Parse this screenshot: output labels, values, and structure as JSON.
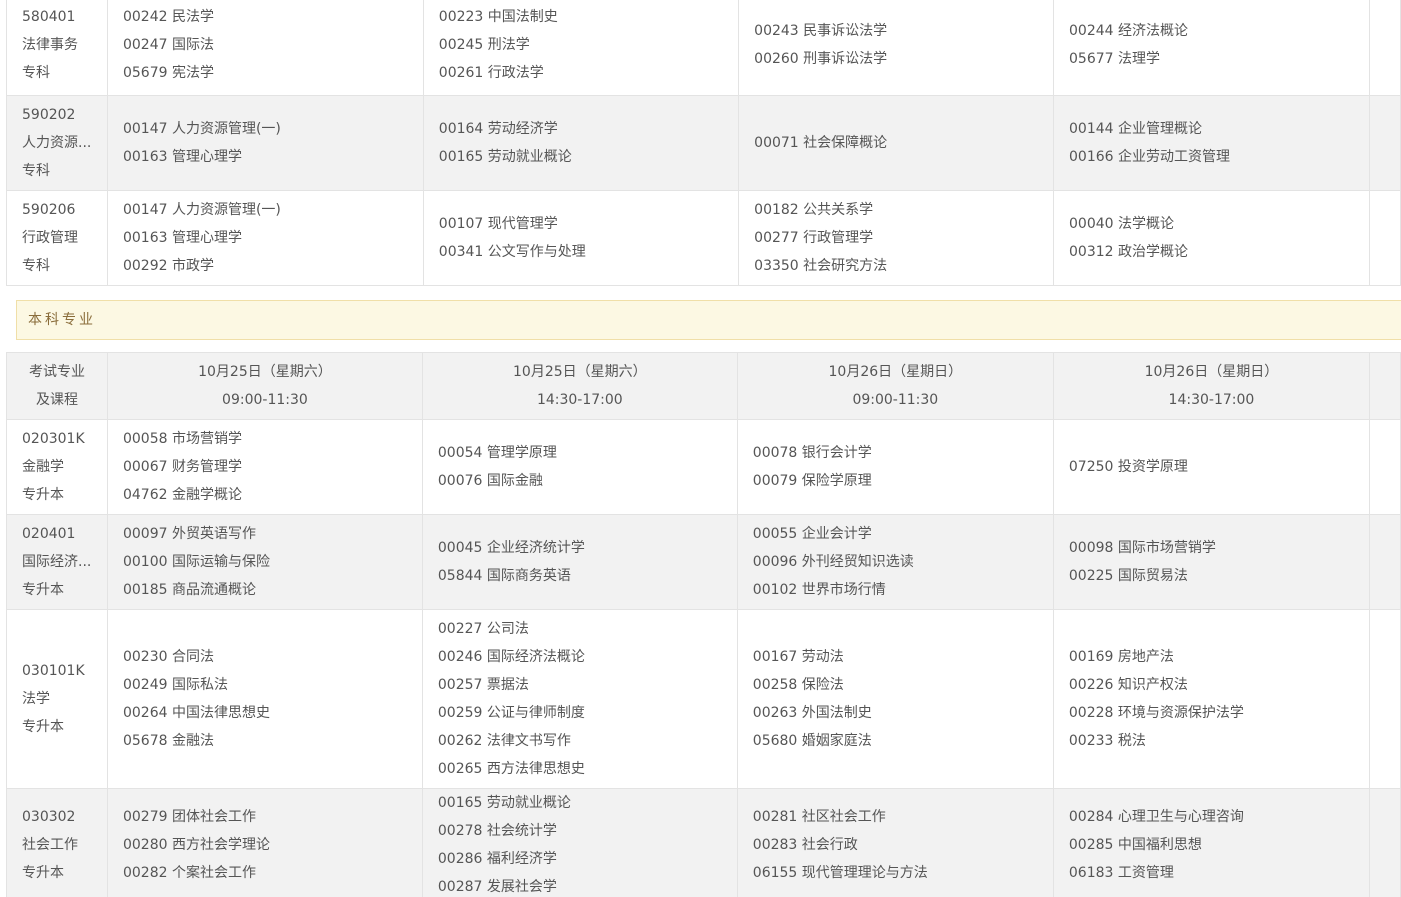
{
  "section_title": "本科专业",
  "header": {
    "col0": [
      "考试专业",
      "及课程"
    ],
    "cols": [
      [
        "10月25日（星期六）",
        "09:00-11:30"
      ],
      [
        "10月25日（星期六）",
        "14:30-17:00"
      ],
      [
        "10月26日（星期日）",
        "09:00-11:30"
      ],
      [
        "10月26日（星期日）",
        "14:30-17:00"
      ]
    ]
  },
  "zhuanke_rows": [
    {
      "code": "580401",
      "name": "法律事务",
      "level": "专科",
      "cells": [
        [
          "00242 民法学",
          "00247 国际法",
          "05679 宪法学"
        ],
        [
          "00223 中国法制史",
          "00245 刑法学",
          "00261 行政法学"
        ],
        [
          "00243 民事诉讼法学",
          "00260 刑事诉讼法学"
        ],
        [
          "00244 经济法概论",
          "05677 法理学"
        ]
      ]
    },
    {
      "code": "590202",
      "name": "人力资源...",
      "level": "专科",
      "cells": [
        [
          "00147 人力资源管理(一)",
          "00163 管理心理学"
        ],
        [
          "00164 劳动经济学",
          "00165 劳动就业概论"
        ],
        [
          "00071 社会保障概论"
        ],
        [
          "00144 企业管理概论",
          "00166 企业劳动工资管理"
        ]
      ]
    },
    {
      "code": "590206",
      "name": "行政管理",
      "level": "专科",
      "cells": [
        [
          "00147 人力资源管理(一)",
          "00163 管理心理学",
          "00292 市政学"
        ],
        [
          "00107 现代管理学",
          "00341 公文写作与处理"
        ],
        [
          "00182 公共关系学",
          "00277 行政管理学",
          "03350 社会研究方法"
        ],
        [
          "00040 法学概论",
          "00312 政治学概论"
        ]
      ]
    }
  ],
  "benke_rows": [
    {
      "code": "020301K",
      "name": "金融学",
      "level": "专升本",
      "cells": [
        [
          "00058 市场营销学",
          "00067 财务管理学",
          "04762 金融学概论"
        ],
        [
          "00054 管理学原理",
          "00076 国际金融"
        ],
        [
          "00078 银行会计学",
          "00079 保险学原理"
        ],
        [
          "07250 投资学原理"
        ]
      ]
    },
    {
      "code": "020401",
      "name": "国际经济...",
      "level": "专升本",
      "cells": [
        [
          "00097 外贸英语写作",
          "00100 国际运输与保险",
          "00185 商品流通概论"
        ],
        [
          "00045 企业经济统计学",
          "05844 国际商务英语"
        ],
        [
          "00055 企业会计学",
          "00096 外刊经贸知识选读",
          "00102 世界市场行情"
        ],
        [
          "00098 国际市场营销学",
          "00225 国际贸易法"
        ]
      ]
    },
    {
      "code": "030101K",
      "name": "法学",
      "level": "专升本",
      "cells": [
        [
          "00230 合同法",
          "00249 国际私法",
          "00264 中国法律思想史",
          "05678 金融法"
        ],
        [
          "00227 公司法",
          "00246 国际经济法概论",
          "00257 票据法",
          "00259 公证与律师制度",
          "00262 法律文书写作",
          "00265 西方法律思想史"
        ],
        [
          "00167 劳动法",
          "00258 保险法",
          "00263 外国法制史",
          "05680 婚姻家庭法"
        ],
        [
          "00169 房地产法",
          "00226 知识产权法",
          "00228 环境与资源保护法学",
          "00233 税法"
        ]
      ]
    },
    {
      "code": "030302",
      "name": "社会工作",
      "level": "专升本",
      "cells": [
        [
          "00279 团体社会工作",
          "00280 西方社会学理论",
          "00282 个案社会工作"
        ],
        [
          "00165 劳动就业概论",
          "00278 社会统计学",
          "00286 福利经济学",
          "00287 发展社会学"
        ],
        [
          "00281 社区社会工作",
          "00283 社会行政",
          "06155 现代管理理论与方法"
        ],
        [
          "00284 心理卫生与心理咨询",
          "00285 中国福利思想",
          "06183 工资管理"
        ]
      ]
    }
  ]
}
